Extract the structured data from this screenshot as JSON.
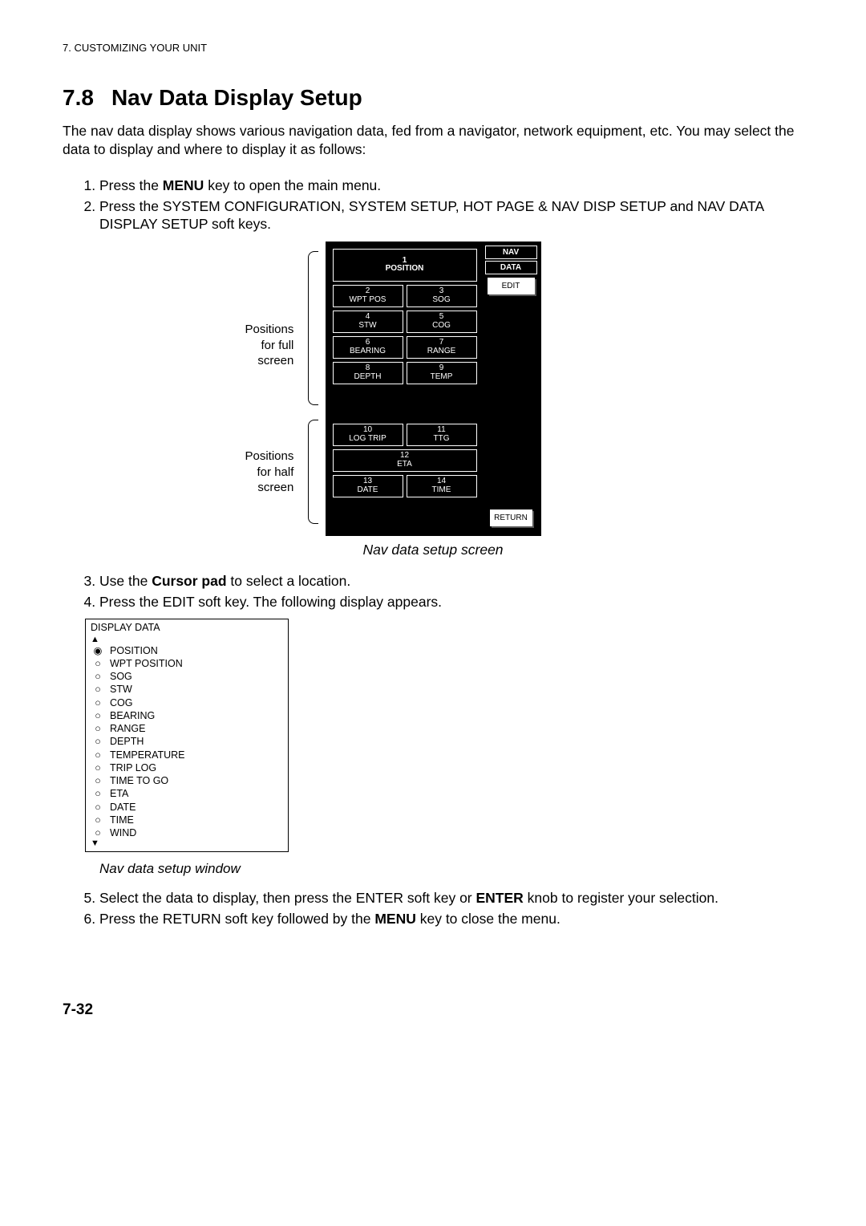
{
  "header": "7. CUSTOMIZING YOUR UNIT",
  "section_number": "7.8",
  "section_title": "Nav Data Display Setup",
  "intro": "The nav data display shows various navigation data, fed from a navigator, network equipment, etc. You may select the data to display and where to display it as follows:",
  "steps": {
    "s1a": "Press the ",
    "s1b": "MENU",
    "s1c": " key to open the main menu.",
    "s2": "Press the SYSTEM CONFIGURATION, SYSTEM SETUP, HOT PAGE & NAV DISP SETUP and NAV DATA DISPLAY SETUP soft keys.",
    "s3a": "Use the ",
    "s3b": "Cursor pad",
    "s3c": " to select a location.",
    "s4": "Press the EDIT soft key. The following display appears.",
    "s5a": "Select the data to display, then press the ENTER soft key or ",
    "s5b": "ENTER",
    "s5c": " knob to register your selection.",
    "s6a": "Press the RETURN soft key followed by the ",
    "s6b": "MENU",
    "s6c": " key to close the menu."
  },
  "fig1": {
    "label_full_1": "Positions",
    "label_full_2": "for full",
    "label_full_3": "screen",
    "label_half_1": "Positions",
    "label_half_2": "for half",
    "label_half_3": "screen",
    "side": {
      "nav": "NAV",
      "data": "DATA",
      "edit": "EDIT",
      "return": "RETURN"
    },
    "cells": {
      "c1n": "1",
      "c1l": "POSITION",
      "c2n": "2",
      "c2l": "WPT POS",
      "c3n": "3",
      "c3l": "SOG",
      "c4n": "4",
      "c4l": "STW",
      "c5n": "5",
      "c5l": "COG",
      "c6n": "6",
      "c6l": "BEARING",
      "c7n": "7",
      "c7l": "RANGE",
      "c8n": "8",
      "c8l": "DEPTH",
      "c9n": "9",
      "c9l": "TEMP",
      "c10n": "10",
      "c10l": "LOG TRIP",
      "c11n": "11",
      "c11l": "TTG",
      "c12n": "12",
      "c12l": "ETA",
      "c13n": "13",
      "c13l": "DATE",
      "c14n": "14",
      "c14l": "TIME"
    },
    "caption": "Nav data setup screen"
  },
  "fig2": {
    "title": "DISPLAY DATA",
    "items": [
      {
        "sel": true,
        "label": "POSITION"
      },
      {
        "sel": false,
        "label": "WPT POSITION"
      },
      {
        "sel": false,
        "label": "SOG"
      },
      {
        "sel": false,
        "label": "STW"
      },
      {
        "sel": false,
        "label": "COG"
      },
      {
        "sel": false,
        "label": "BEARING"
      },
      {
        "sel": false,
        "label": "RANGE"
      },
      {
        "sel": false,
        "label": "DEPTH"
      },
      {
        "sel": false,
        "label": "TEMPERATURE"
      },
      {
        "sel": false,
        "label": "TRIP LOG"
      },
      {
        "sel": false,
        "label": "TIME TO GO"
      },
      {
        "sel": false,
        "label": "ETA"
      },
      {
        "sel": false,
        "label": "DATE"
      },
      {
        "sel": false,
        "label": "TIME"
      },
      {
        "sel": false,
        "label": "WIND"
      }
    ],
    "caption": "Nav data setup window"
  },
  "page_num": "7-32"
}
